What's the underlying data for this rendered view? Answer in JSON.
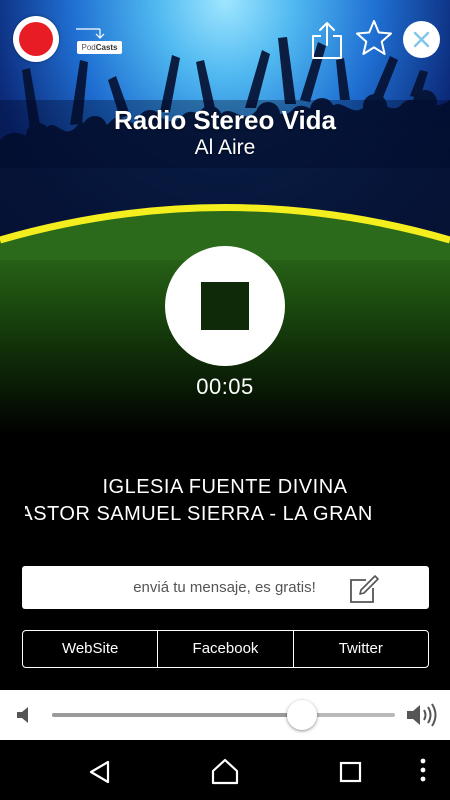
{
  "header": {
    "record_icon": "record-icon",
    "podcasts_label_prefix": "Pod",
    "podcasts_label_suffix": "Casts",
    "share_icon": "share-icon",
    "favorite_icon": "star-icon",
    "close_icon": "close-icon"
  },
  "station": {
    "name": "Radio Stereo Vida",
    "status": "Al Aire"
  },
  "player": {
    "stop_icon": "stop-icon",
    "elapsed": "00:05"
  },
  "program": {
    "line1": "IGLESIA FUENTE DIVINA",
    "line2": "PASTOR SAMUEL SIERRA - LA GRAN"
  },
  "message": {
    "placeholder": "enviá tu mensaje, es gratis!",
    "icon": "compose-icon"
  },
  "links": [
    {
      "label": "WebSite"
    },
    {
      "label": "Facebook"
    },
    {
      "label": "Twitter"
    }
  ],
  "volume": {
    "level": 0.73,
    "low_icon": "volume-low-icon",
    "high_icon": "volume-high-icon"
  },
  "navbar": {
    "back_icon": "back-icon",
    "home_icon": "home-icon",
    "recent_icon": "recent-apps-icon",
    "menu_icon": "overflow-menu-icon"
  },
  "colors": {
    "record": "#e81c24",
    "arc_yellow": "#f5ee1e",
    "field_green": "#2b6a1a"
  }
}
